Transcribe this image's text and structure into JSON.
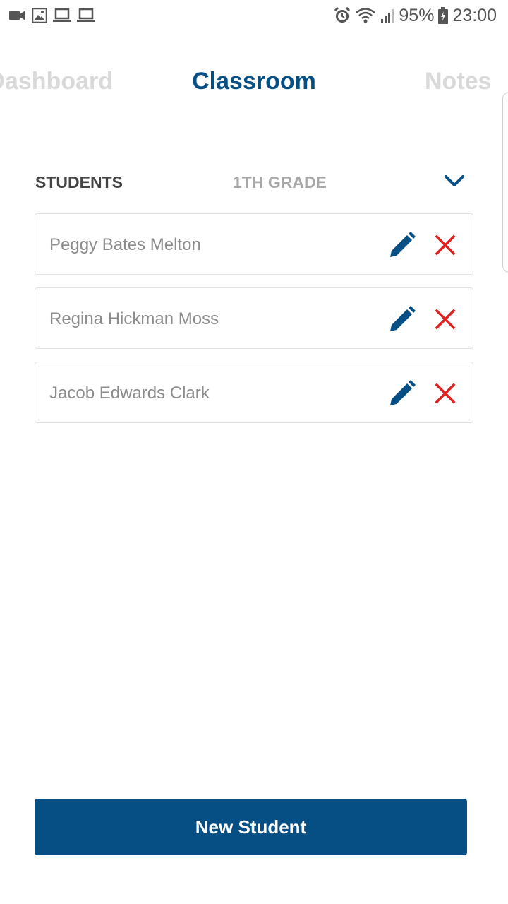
{
  "status_bar": {
    "left_icons": [
      "video-call-icon",
      "image-icon",
      "laptop-icon",
      "laptop-icon"
    ],
    "right_icons": [
      "alarm-icon",
      "wifi-icon",
      "cell-signal-icon",
      "battery-icon"
    ],
    "battery": "95%",
    "time": "23:00"
  },
  "tabs": {
    "dashboard": "Dashboard",
    "classroom": "Classroom",
    "notes": "Notes"
  },
  "students_section": {
    "label": "STUDENTS",
    "grade": "1TH GRADE"
  },
  "students": [
    {
      "name": "Peggy Bates Melton"
    },
    {
      "name": "Regina Hickman Moss"
    },
    {
      "name": "Jacob Edwards Clark"
    }
  ],
  "actions": {
    "new_student": "New Student"
  },
  "colors": {
    "primary": "#054f85",
    "delete": "#e0201e",
    "tab_inactive": "#d9d9d9",
    "text_muted": "#8c8c8c"
  }
}
